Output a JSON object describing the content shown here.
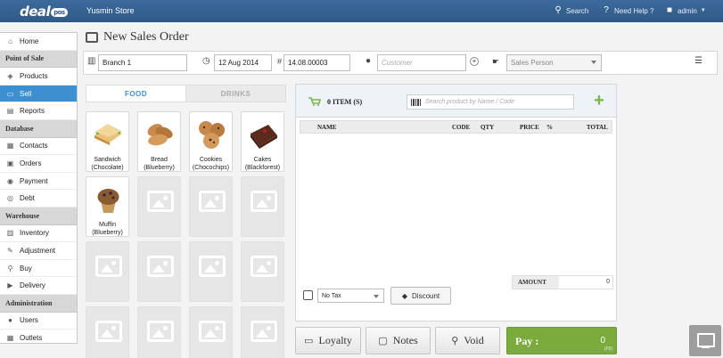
{
  "topbar": {
    "logo": "deal",
    "logo_badge": "pos",
    "store": "Yusmin Store",
    "search": "Search",
    "help": "Need Help ?",
    "user": "admin"
  },
  "sidebar": {
    "items": [
      {
        "type": "item",
        "label": "Home",
        "icon": "home-icon",
        "glyph": "⌂"
      },
      {
        "type": "head",
        "label": "Point of Sale"
      },
      {
        "type": "item",
        "label": "Products",
        "icon": "tag-icon",
        "glyph": "◈"
      },
      {
        "type": "item",
        "label": "Sell",
        "icon": "monitor-icon",
        "glyph": "▭",
        "active": true
      },
      {
        "type": "item",
        "label": "Reports",
        "icon": "chart-icon",
        "glyph": "▤"
      },
      {
        "type": "head",
        "label": "Database"
      },
      {
        "type": "item",
        "label": "Contacts",
        "icon": "contacts-icon",
        "glyph": "▦"
      },
      {
        "type": "item",
        "label": "Orders",
        "icon": "orders-icon",
        "glyph": "▣"
      },
      {
        "type": "item",
        "label": "Payment",
        "icon": "payment-icon",
        "glyph": "◉"
      },
      {
        "type": "item",
        "label": "Debt",
        "icon": "debt-icon",
        "glyph": "◎"
      },
      {
        "type": "head",
        "label": "Warehouse"
      },
      {
        "type": "item",
        "label": "Inventory",
        "icon": "inventory-icon",
        "glyph": "▥"
      },
      {
        "type": "item",
        "label": "Adjustment",
        "icon": "adjustment-icon",
        "glyph": "✎"
      },
      {
        "type": "item",
        "label": "Buy",
        "icon": "cart-icon",
        "glyph": "⚲"
      },
      {
        "type": "item",
        "label": "Delivery",
        "icon": "truck-icon",
        "glyph": "▶"
      },
      {
        "type": "head",
        "label": "Administration"
      },
      {
        "type": "item",
        "label": "Users",
        "icon": "user-icon",
        "glyph": "●"
      },
      {
        "type": "item",
        "label": "Outlets",
        "icon": "outlet-icon",
        "glyph": "▦"
      }
    ]
  },
  "page": {
    "title": "New Sales Order"
  },
  "form": {
    "branch": "Branch 1",
    "date": "12 Aug 2014",
    "number_prefix": "#",
    "number": "14.08.00003",
    "customer_placeholder": "Customer",
    "sales_person_placeholder": "Sales Person"
  },
  "tabs": {
    "food": "FOOD",
    "drinks": "DRINKS"
  },
  "products": [
    {
      "name": "Sandwich",
      "variant": "(Chocolate)",
      "icon": "sandwich-icon"
    },
    {
      "name": "Bread",
      "variant": "(Blueberry)",
      "icon": "bread-icon"
    },
    {
      "name": "Cookies",
      "variant": "(Chocochips)",
      "icon": "cookies-icon"
    },
    {
      "name": "Cakes",
      "variant": "(Blackforest)",
      "icon": "cake-icon"
    },
    {
      "name": "Muffin",
      "variant": "(Blueberry)",
      "icon": "muffin-icon"
    }
  ],
  "order": {
    "item_count": "0 ITEM (S)",
    "search_placeholder": "Search product by Name / Code",
    "columns": {
      "name": "NAME",
      "code": "CODE",
      "qty": "QTY",
      "price": "PRICE",
      "pct": "%",
      "total": "TOTAL"
    },
    "amount_label": "AMOUNT",
    "amount_value": "0",
    "tax": "No Tax",
    "discount": "Discount"
  },
  "buttons": {
    "loyalty": "Loyalty",
    "notes": "Notes",
    "void": "Void",
    "pay": "Pay :",
    "pay_value": "0",
    "pay_key": "(F8)"
  },
  "colors": {
    "topbar": "#2f5987",
    "active": "#3d8fd0",
    "pay": "#7cab3d",
    "add": "#7cb342"
  }
}
